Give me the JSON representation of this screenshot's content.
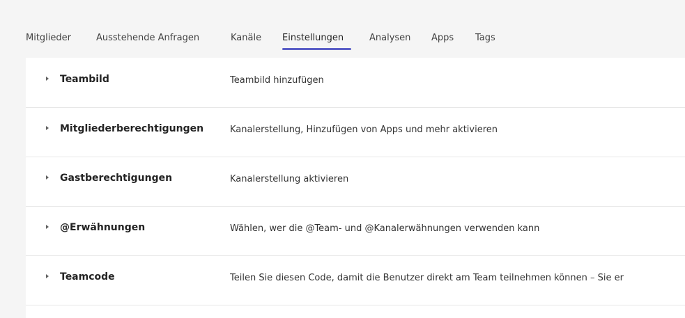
{
  "tabs": {
    "items": [
      {
        "label": "Mitglieder"
      },
      {
        "label": "Ausstehende Anfragen"
      },
      {
        "label": "Kanäle"
      },
      {
        "label": "Einstellungen",
        "active": true
      },
      {
        "label": "Analysen"
      },
      {
        "label": "Apps"
      },
      {
        "label": "Tags"
      }
    ]
  },
  "settings": [
    {
      "title": "Teambild",
      "description": "Teambild hinzufügen"
    },
    {
      "title": "Mitgliederberechtigungen",
      "description": "Kanalerstellung, Hinzufügen von Apps und mehr aktivieren"
    },
    {
      "title": "Gastberechtigungen",
      "description": "Kanalerstellung aktivieren"
    },
    {
      "title": "@Erwähnungen",
      "description": "Wählen, wer die @Team- und @Kanalerwähnungen verwenden kann"
    },
    {
      "title": "Teamcode",
      "description": "Teilen Sie diesen Code, damit die Benutzer direkt am Team teilnehmen können – Sie er"
    }
  ],
  "colors": {
    "accent": "#5b5fc7",
    "panel": "#ffffff",
    "background": "#f5f5f5"
  }
}
